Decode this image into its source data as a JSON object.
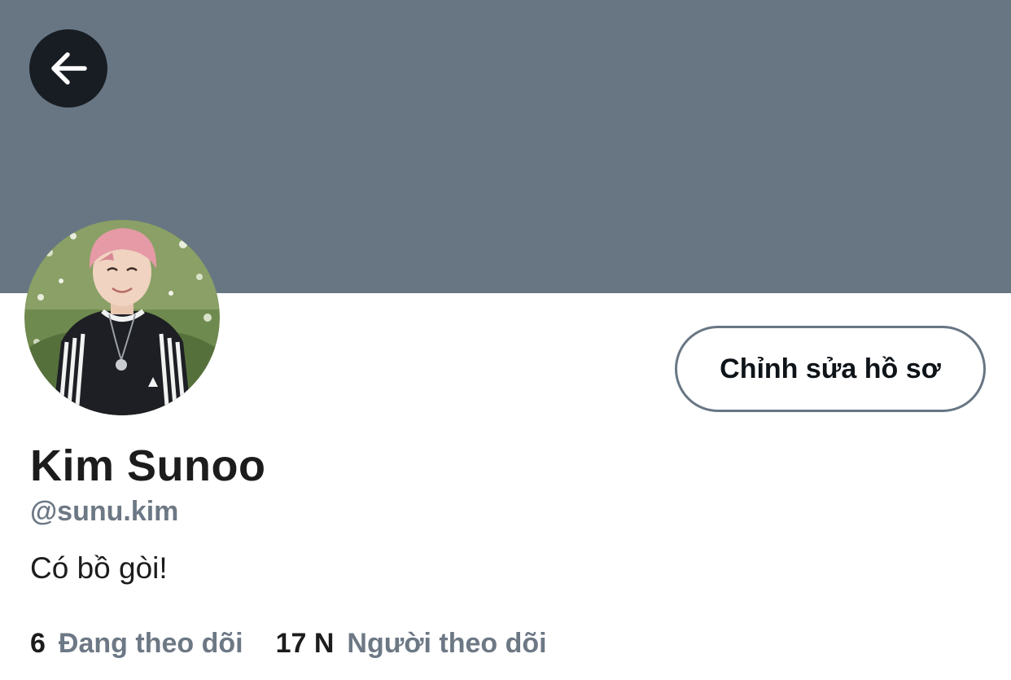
{
  "header": {
    "back_icon": "arrow-left-icon",
    "banner_color": "#687684"
  },
  "profile": {
    "avatar_alt": "profile photo",
    "edit_button_label": "Chỉnh sửa hồ sơ",
    "display_name": "Kim Sunoo",
    "handle": "@sunu.kim",
    "bio": "Có bồ gòi!"
  },
  "stats": {
    "following_count": "6",
    "following_label": "Đang theo dõi",
    "followers_count": "17 N",
    "followers_label": "Người theo dõi"
  }
}
